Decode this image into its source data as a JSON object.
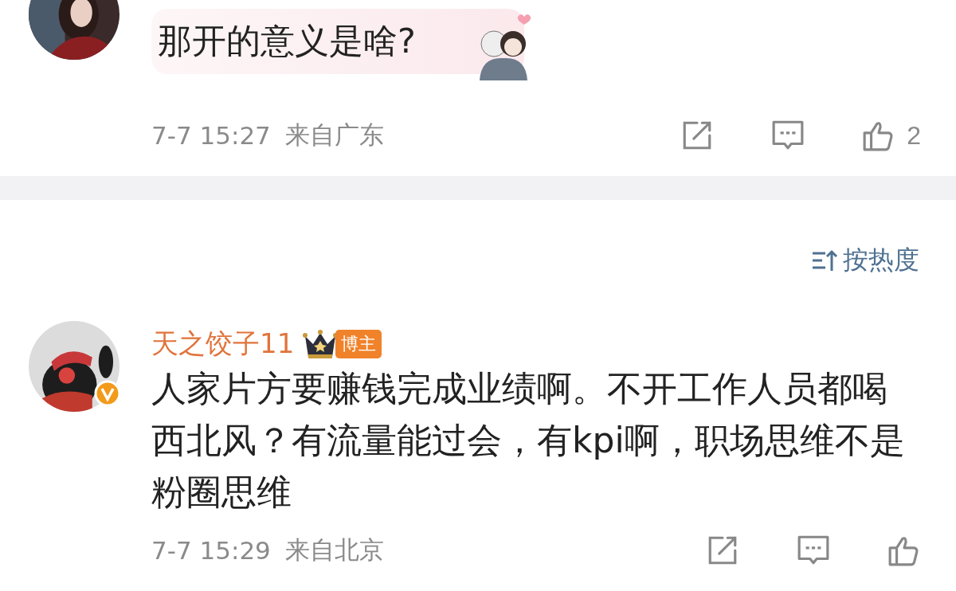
{
  "comments": [
    {
      "text": "那开的意义是啥?",
      "time": "7-7 15:27",
      "location": "来自广东",
      "likes": "2"
    }
  ],
  "sort": {
    "label": "按热度"
  },
  "replies": [
    {
      "verified": true,
      "name": "天之饺子11",
      "badge": "博主",
      "text": "人家片方要赚钱完成业绩啊。不开工作人员都喝西北风？有流量能过会，有kpi啊，职场思维不是粉圈思维",
      "time": "7-7 15:29",
      "location": "来自北京"
    }
  ]
}
